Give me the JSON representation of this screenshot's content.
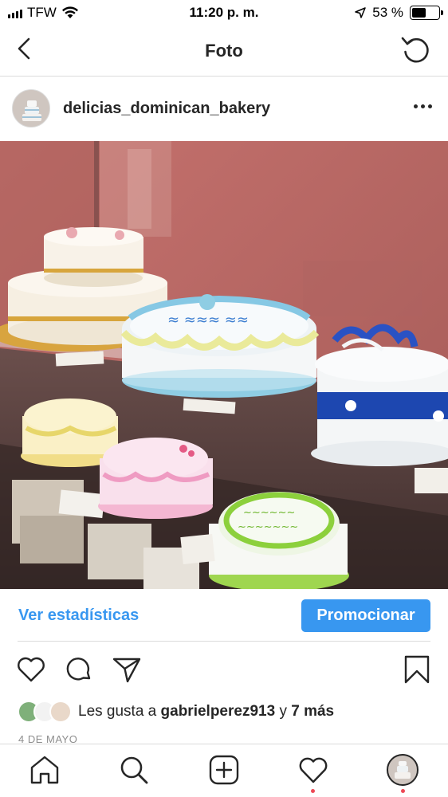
{
  "status_bar": {
    "carrier": "TFW",
    "time": "11:20 p. m.",
    "battery": "53 %",
    "battery_level": 0.53
  },
  "nav": {
    "title": "Foto"
  },
  "post": {
    "username": "delicias_dominican_bakery",
    "image_alt": "Display case with decorated cakes",
    "stats_link": "Ver estadísticas",
    "promote_button": "Promocionar",
    "likes_prefix": "Les gusta a",
    "liked_by_user": "gabrielperez913",
    "likes_middle": "y",
    "likes_others": "7 más",
    "date": "4 DE MAYO"
  },
  "icons": {
    "back": "chevron-left-icon",
    "refresh": "refresh-icon",
    "more": "more-horizontal-icon",
    "like": "heart-icon",
    "comment": "comment-icon",
    "share": "send-icon",
    "save": "bookmark-icon",
    "home": "home-icon",
    "search": "search-icon",
    "new_post": "plus-square-icon",
    "activity": "heart-icon",
    "profile": "profile-avatar"
  },
  "colors": {
    "accent": "#3897f0",
    "text": "#262626",
    "muted": "#8e8e8e",
    "notification": "#ed4956"
  }
}
